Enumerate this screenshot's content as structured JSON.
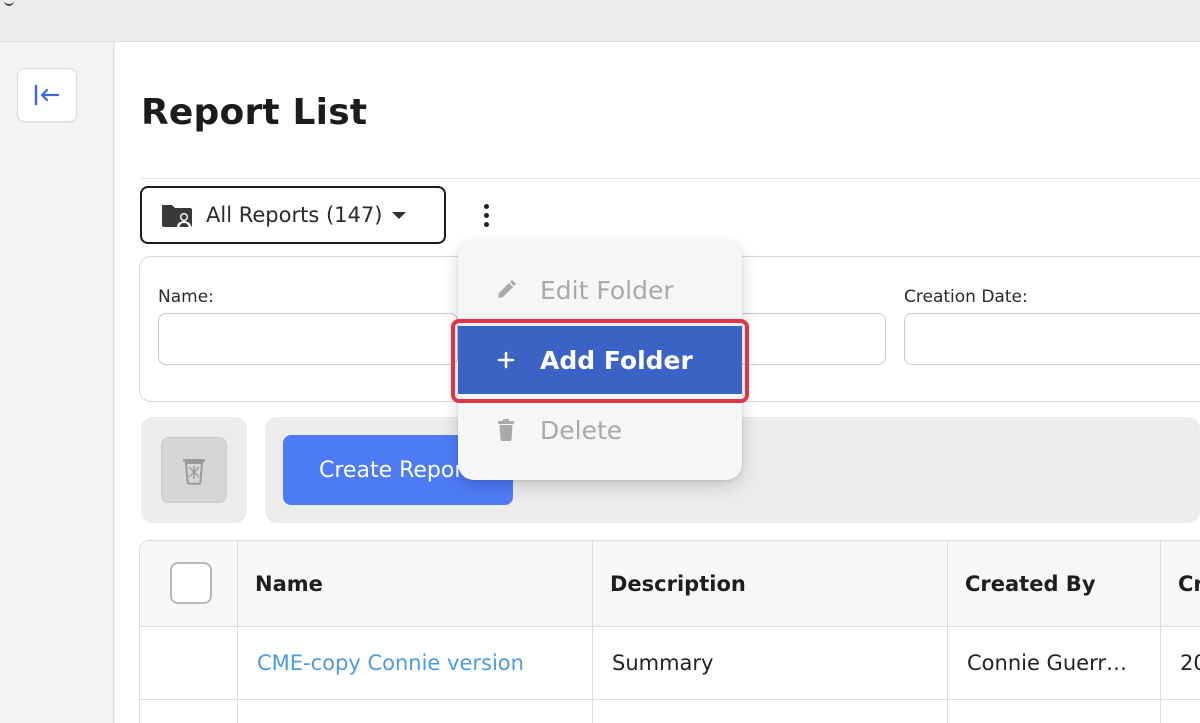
{
  "page": {
    "title": "Report List"
  },
  "folder_selector": {
    "label": "All Reports (147)"
  },
  "folder_menu": {
    "items": [
      {
        "label": "Edit Folder",
        "icon": "pencil-icon",
        "state": "disabled"
      },
      {
        "label": "Add Folder",
        "icon": "plus-icon",
        "state": "highlighted"
      },
      {
        "label": "Delete",
        "icon": "trash-icon",
        "state": "disabled"
      }
    ]
  },
  "filters": {
    "name_label": "Name:",
    "creation_date_label": "Creation Date:",
    "name_value": "",
    "description_value": "",
    "creation_date_value": ""
  },
  "actions": {
    "create_label": "Create Report"
  },
  "table": {
    "columns": [
      "Name",
      "Description",
      "Created By",
      "Cr"
    ],
    "rows": [
      {
        "name": "CME-copy Connie version",
        "description": "Summary",
        "created_by": "Connie Guerr…",
        "created": "20"
      }
    ]
  },
  "colors": {
    "accent": "#3b62c5",
    "primary_button": "#4d7cf6",
    "link": "#4a9be0",
    "highlight": "#e0344b"
  }
}
